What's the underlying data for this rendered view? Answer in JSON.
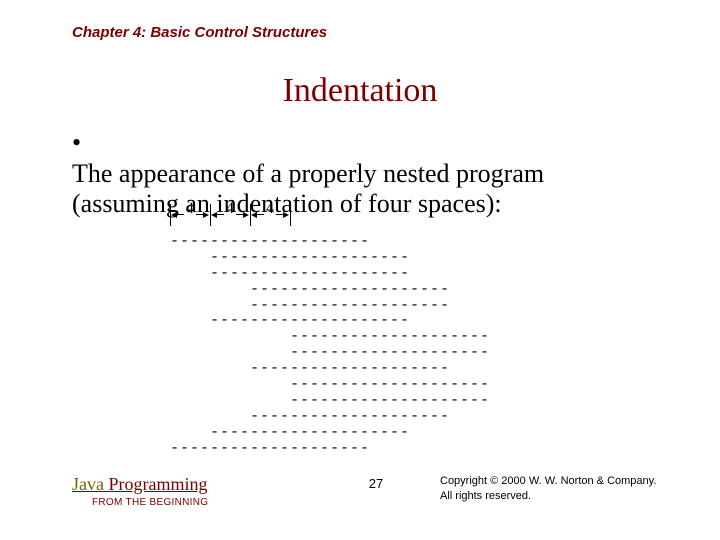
{
  "chapter": "Chapter 4: Basic Control Structures",
  "title": "Indentation",
  "bullet": "The appearance of a properly nested program (assuming an indentation of four spaces):",
  "ruler": {
    "a": "4",
    "b": "4",
    "c": "4"
  },
  "lines": [
    {
      "indent": 0
    },
    {
      "indent": 1
    },
    {
      "indent": 1
    },
    {
      "indent": 2
    },
    {
      "indent": 2
    },
    {
      "indent": 1
    },
    {
      "indent": 3
    },
    {
      "indent": 3
    },
    {
      "indent": 2
    },
    {
      "indent": 3
    },
    {
      "indent": 3
    },
    {
      "indent": 2
    },
    {
      "indent": 1
    },
    {
      "indent": 0
    }
  ],
  "footer": {
    "java": "Java",
    "programming": " Programming",
    "sub": "FROM THE BEGINNING",
    "page": "27",
    "copy1": "Copyright © 2000 W. W. Norton & Company.",
    "copy2": "All rights reserved."
  }
}
